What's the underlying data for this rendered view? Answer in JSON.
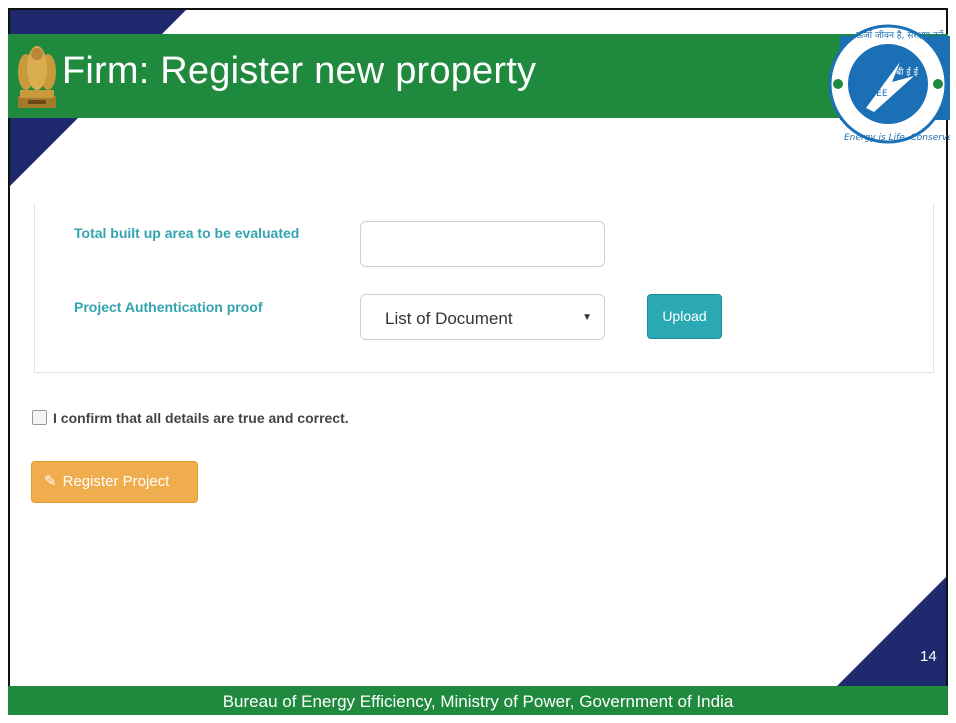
{
  "header": {
    "title": "Firm: Register new property"
  },
  "form": {
    "built_up_area_label": "Total built up area to be evaluated",
    "built_up_area_value": "",
    "auth_proof_label": "Project Authentication proof",
    "auth_proof_selected": "List of Document",
    "upload_label": "Upload"
  },
  "confirm": {
    "label": "I confirm that all details are true and correct.",
    "checked": false
  },
  "register_button": {
    "label": "Register Project",
    "icon": "pencil-icon"
  },
  "footer": {
    "text": "Bureau of Energy Efficiency, Ministry of Power, Government of India",
    "page_number": "14"
  },
  "logo": {
    "hindi_text": "ऊर्जा जीवन है, संरक्षण करें",
    "english_text": "Energy is Life, Conserve it",
    "abbr": "BEE"
  },
  "colors": {
    "header_green": "#1f8a3e",
    "corner_navy": "#1f2a6e",
    "label_teal": "#33a3b0",
    "upload_teal": "#2aa9b5",
    "register_orange": "#f0ad4e"
  }
}
